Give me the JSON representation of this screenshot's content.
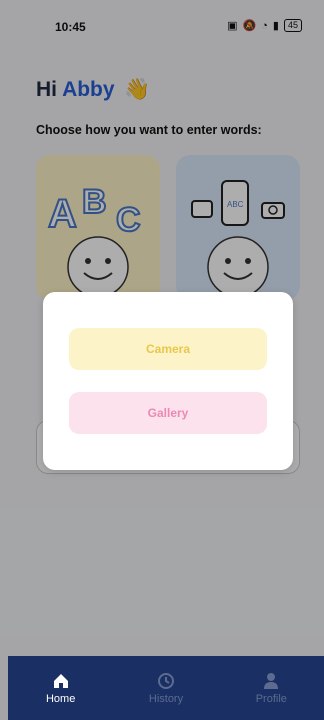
{
  "status_bar": {
    "time": "10:45",
    "battery": "45"
  },
  "header": {
    "greeting": "Hi",
    "name": "Abby",
    "wave_emoji": "👋"
  },
  "prompt": "Choose how you want to enter words:",
  "cards": [
    {
      "icon": "abc-smiley-illustration"
    },
    {
      "icon": "photo-phone-smiley-illustration"
    }
  ],
  "modal": {
    "camera_label": "Camera",
    "gallery_label": "Gallery"
  },
  "nav": {
    "items": [
      {
        "label": "Home",
        "icon": "home-icon"
      },
      {
        "label": "History",
        "icon": "history-icon"
      },
      {
        "label": "Profile",
        "icon": "profile-icon"
      }
    ]
  },
  "colors": {
    "accent": "#2a5fd6",
    "nav_bg": "#1a2f63",
    "camera_bg": "#fdf3c8",
    "camera_text": "#e8c84a",
    "gallery_bg": "#fbe2ec",
    "gallery_text": "#ec8ab5"
  }
}
